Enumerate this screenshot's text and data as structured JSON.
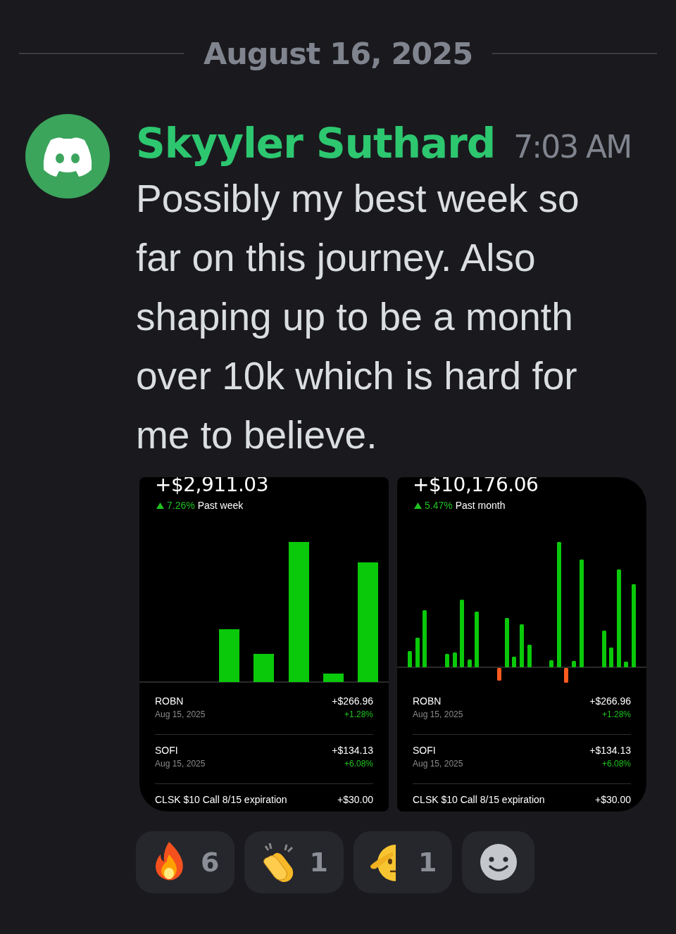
{
  "date_divider": "August 16, 2025",
  "message": {
    "author": "Skyyler Suthard",
    "timestamp": "7:03 AM",
    "text": "Possibly my best week so far on this journey. Also shaping up to be a month over 10k which is hard for me to believe.",
    "attachments": [
      {
        "total": "+$2,911.03",
        "change": "7.26%",
        "period": "Past week",
        "kind": "week",
        "rows": [
          {
            "symbol": "ROBN",
            "date": "Aug 15, 2025",
            "amount": "+$266.96",
            "percent": "+1.28%"
          },
          {
            "symbol": "SOFI",
            "date": "Aug 15, 2025",
            "amount": "+$134.13",
            "percent": "+6.08%"
          },
          {
            "symbol": "CLSK $10 Call 8/15 expiration",
            "amount": "+$30.00"
          }
        ]
      },
      {
        "total": "+$10,176.06",
        "change": "5.47%",
        "period": "Past month",
        "kind": "month",
        "rows": [
          {
            "symbol": "ROBN",
            "date": "Aug 15, 2025",
            "amount": "+$266.96",
            "percent": "+1.28%"
          },
          {
            "symbol": "SOFI",
            "date": "Aug 15, 2025",
            "amount": "+$134.13",
            "percent": "+6.08%"
          },
          {
            "symbol": "CLSK $10 Call 8/15 expiration",
            "amount": "+$30.00"
          }
        ]
      }
    ]
  },
  "reactions": [
    {
      "kind": "fire",
      "count": "6"
    },
    {
      "kind": "clap",
      "count": "1"
    },
    {
      "kind": "salute",
      "count": "1"
    },
    {
      "kind": "add"
    }
  ]
}
